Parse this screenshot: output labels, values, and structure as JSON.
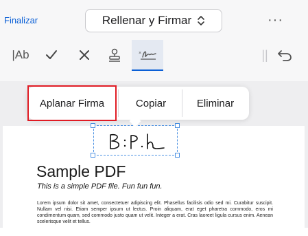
{
  "header": {
    "finalize_label": "Finalizar",
    "mode_select_value": "Rellenar y Firmar",
    "more_label": "···"
  },
  "toolbar": {
    "tools": [
      {
        "name": "text-tool",
        "label": "|Ab",
        "icon": "text-ab-icon"
      },
      {
        "name": "check-tool",
        "icon": "checkmark-icon"
      },
      {
        "name": "cross-tool",
        "icon": "cross-icon"
      },
      {
        "name": "stamp-tool",
        "icon": "stamp-icon"
      },
      {
        "name": "signature-tool",
        "icon": "signature-icon",
        "selected": true
      }
    ],
    "pipes_label": "||",
    "undo_icon": "undo-icon"
  },
  "context_menu": {
    "items": [
      "Aplanar Firma",
      "Copiar",
      "Eliminar"
    ],
    "highlighted": "Aplanar Firma"
  },
  "document": {
    "title": "Sample PDF",
    "subtitle": "This is a simple PDF file. Fun fun fun.",
    "body": "Lorem ipsum dolor sit amet, consectetuer adipiscing elit. Phasellus facilisis odio sed mi. Curabitur suscipit. Nullam vel nisi. Etiam semper ipsum ut lectus. Proin aliquam, erat eget pharetra commodo, eros mi condimentum quam, sed commodo justo quam ut velit. Integer a erat. Cras laoreet ligula cursus enim. Aenean scelerisque velit et tellus."
  },
  "colors": {
    "accent": "#0a5fd6",
    "selection": "#4a90e2",
    "highlight_outline": "#e01b24"
  }
}
